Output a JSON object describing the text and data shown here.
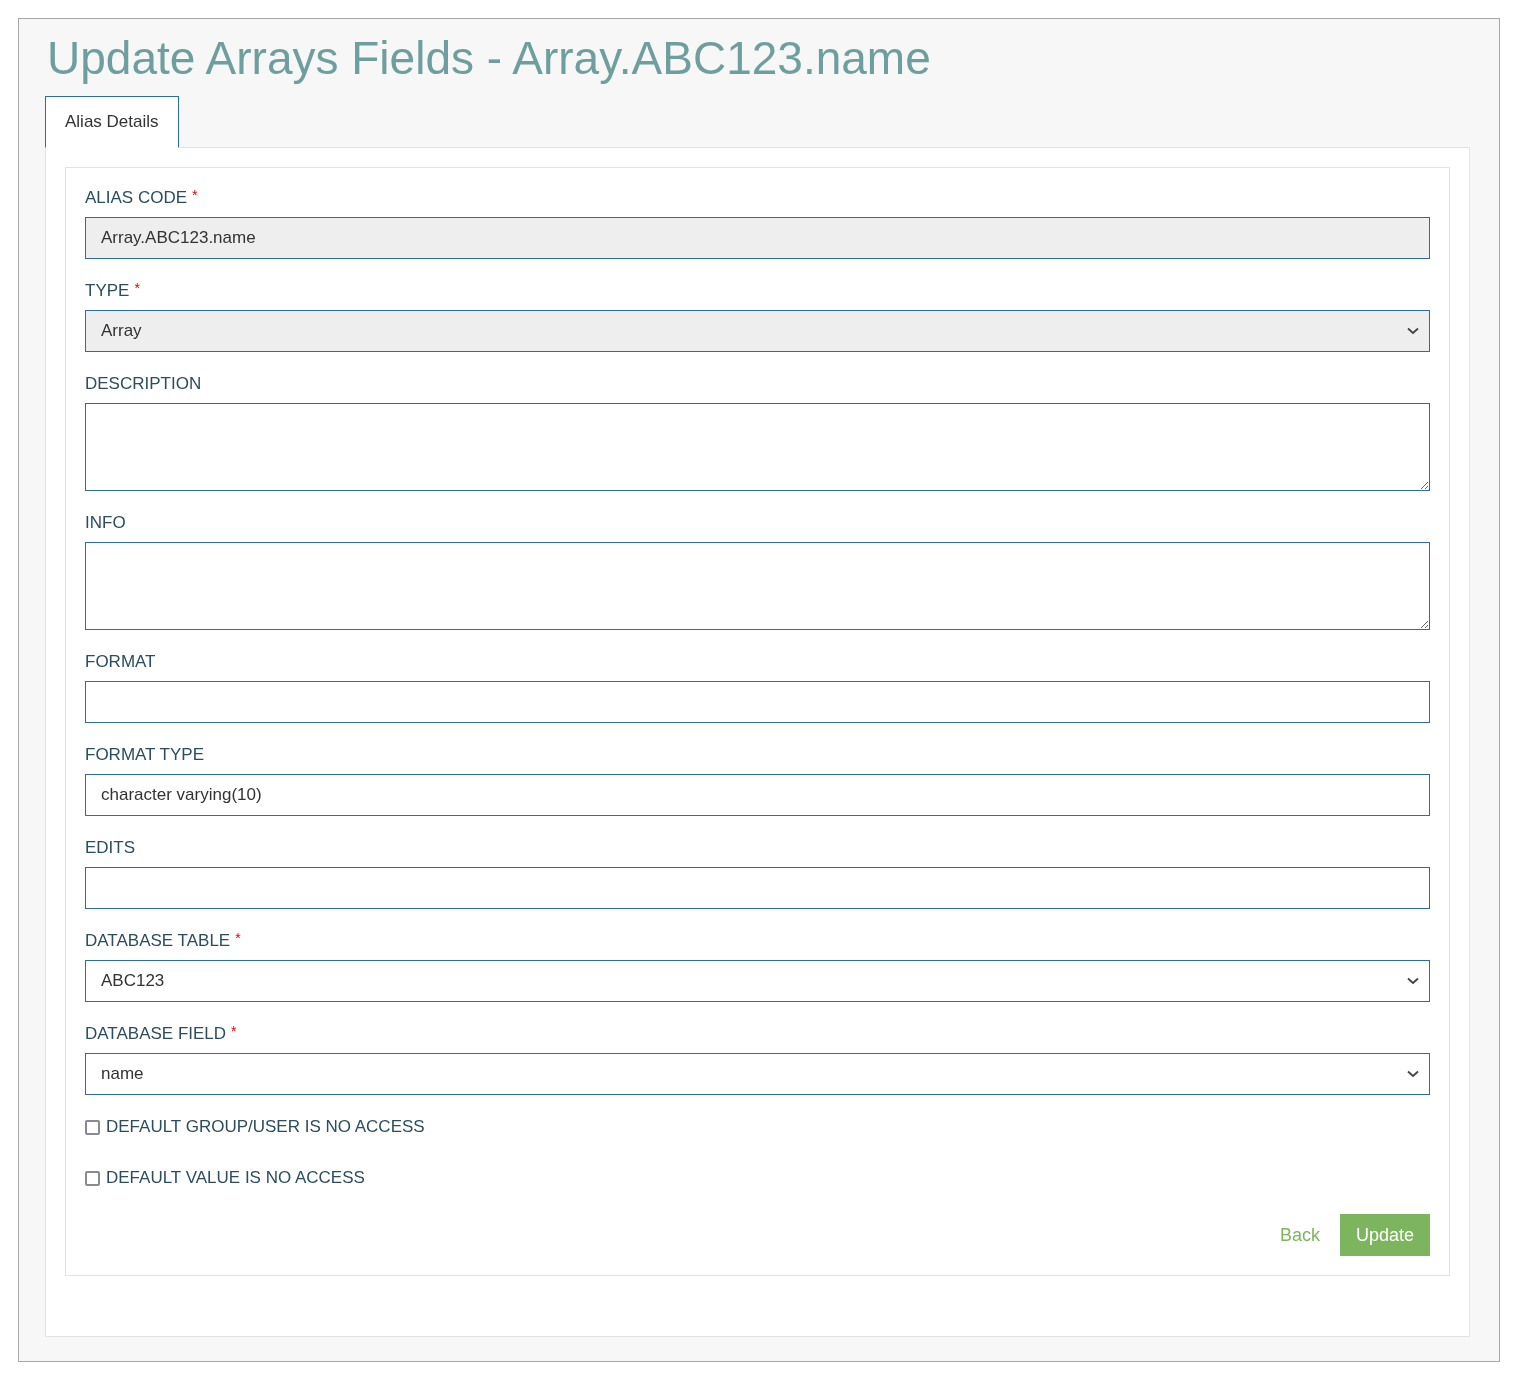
{
  "title": "Update Arrays Fields - Array.ABC123.name",
  "tabs": [
    {
      "label": "Alias Details",
      "selected": true
    }
  ],
  "fields": [
    {
      "label": "ALIAS CODE",
      "required_mark": "*",
      "kind": "input",
      "value": "Array.ABC123.name",
      "disabled": true
    },
    {
      "label": "TYPE",
      "required_mark": "*",
      "kind": "select",
      "value": "Array",
      "disabled": true
    },
    {
      "label": "DESCRIPTION",
      "kind": "textarea",
      "disabled": false
    },
    {
      "label": "INFO",
      "kind": "textarea",
      "disabled": false
    },
    {
      "label": "FORMAT",
      "kind": "input",
      "disabled": false
    },
    {
      "label": "FORMAT TYPE",
      "kind": "input",
      "value": "character varying(10)",
      "disabled": false
    },
    {
      "label": "EDITS",
      "kind": "input",
      "disabled": false
    },
    {
      "label": "DATABASE TABLE",
      "required_mark": "*",
      "kind": "select",
      "value": "ABC123",
      "disabled": false
    },
    {
      "label": "DATABASE FIELD",
      "required_mark": "*",
      "kind": "select",
      "value": "name",
      "disabled": false
    }
  ],
  "checkboxes": [
    {
      "label": "DEFAULT GROUP/USER IS NO ACCESS",
      "checked": false
    },
    {
      "label": "DEFAULT VALUE IS NO ACCESS",
      "checked": false
    }
  ],
  "actions": {
    "back": "Back",
    "submit": "Update"
  }
}
